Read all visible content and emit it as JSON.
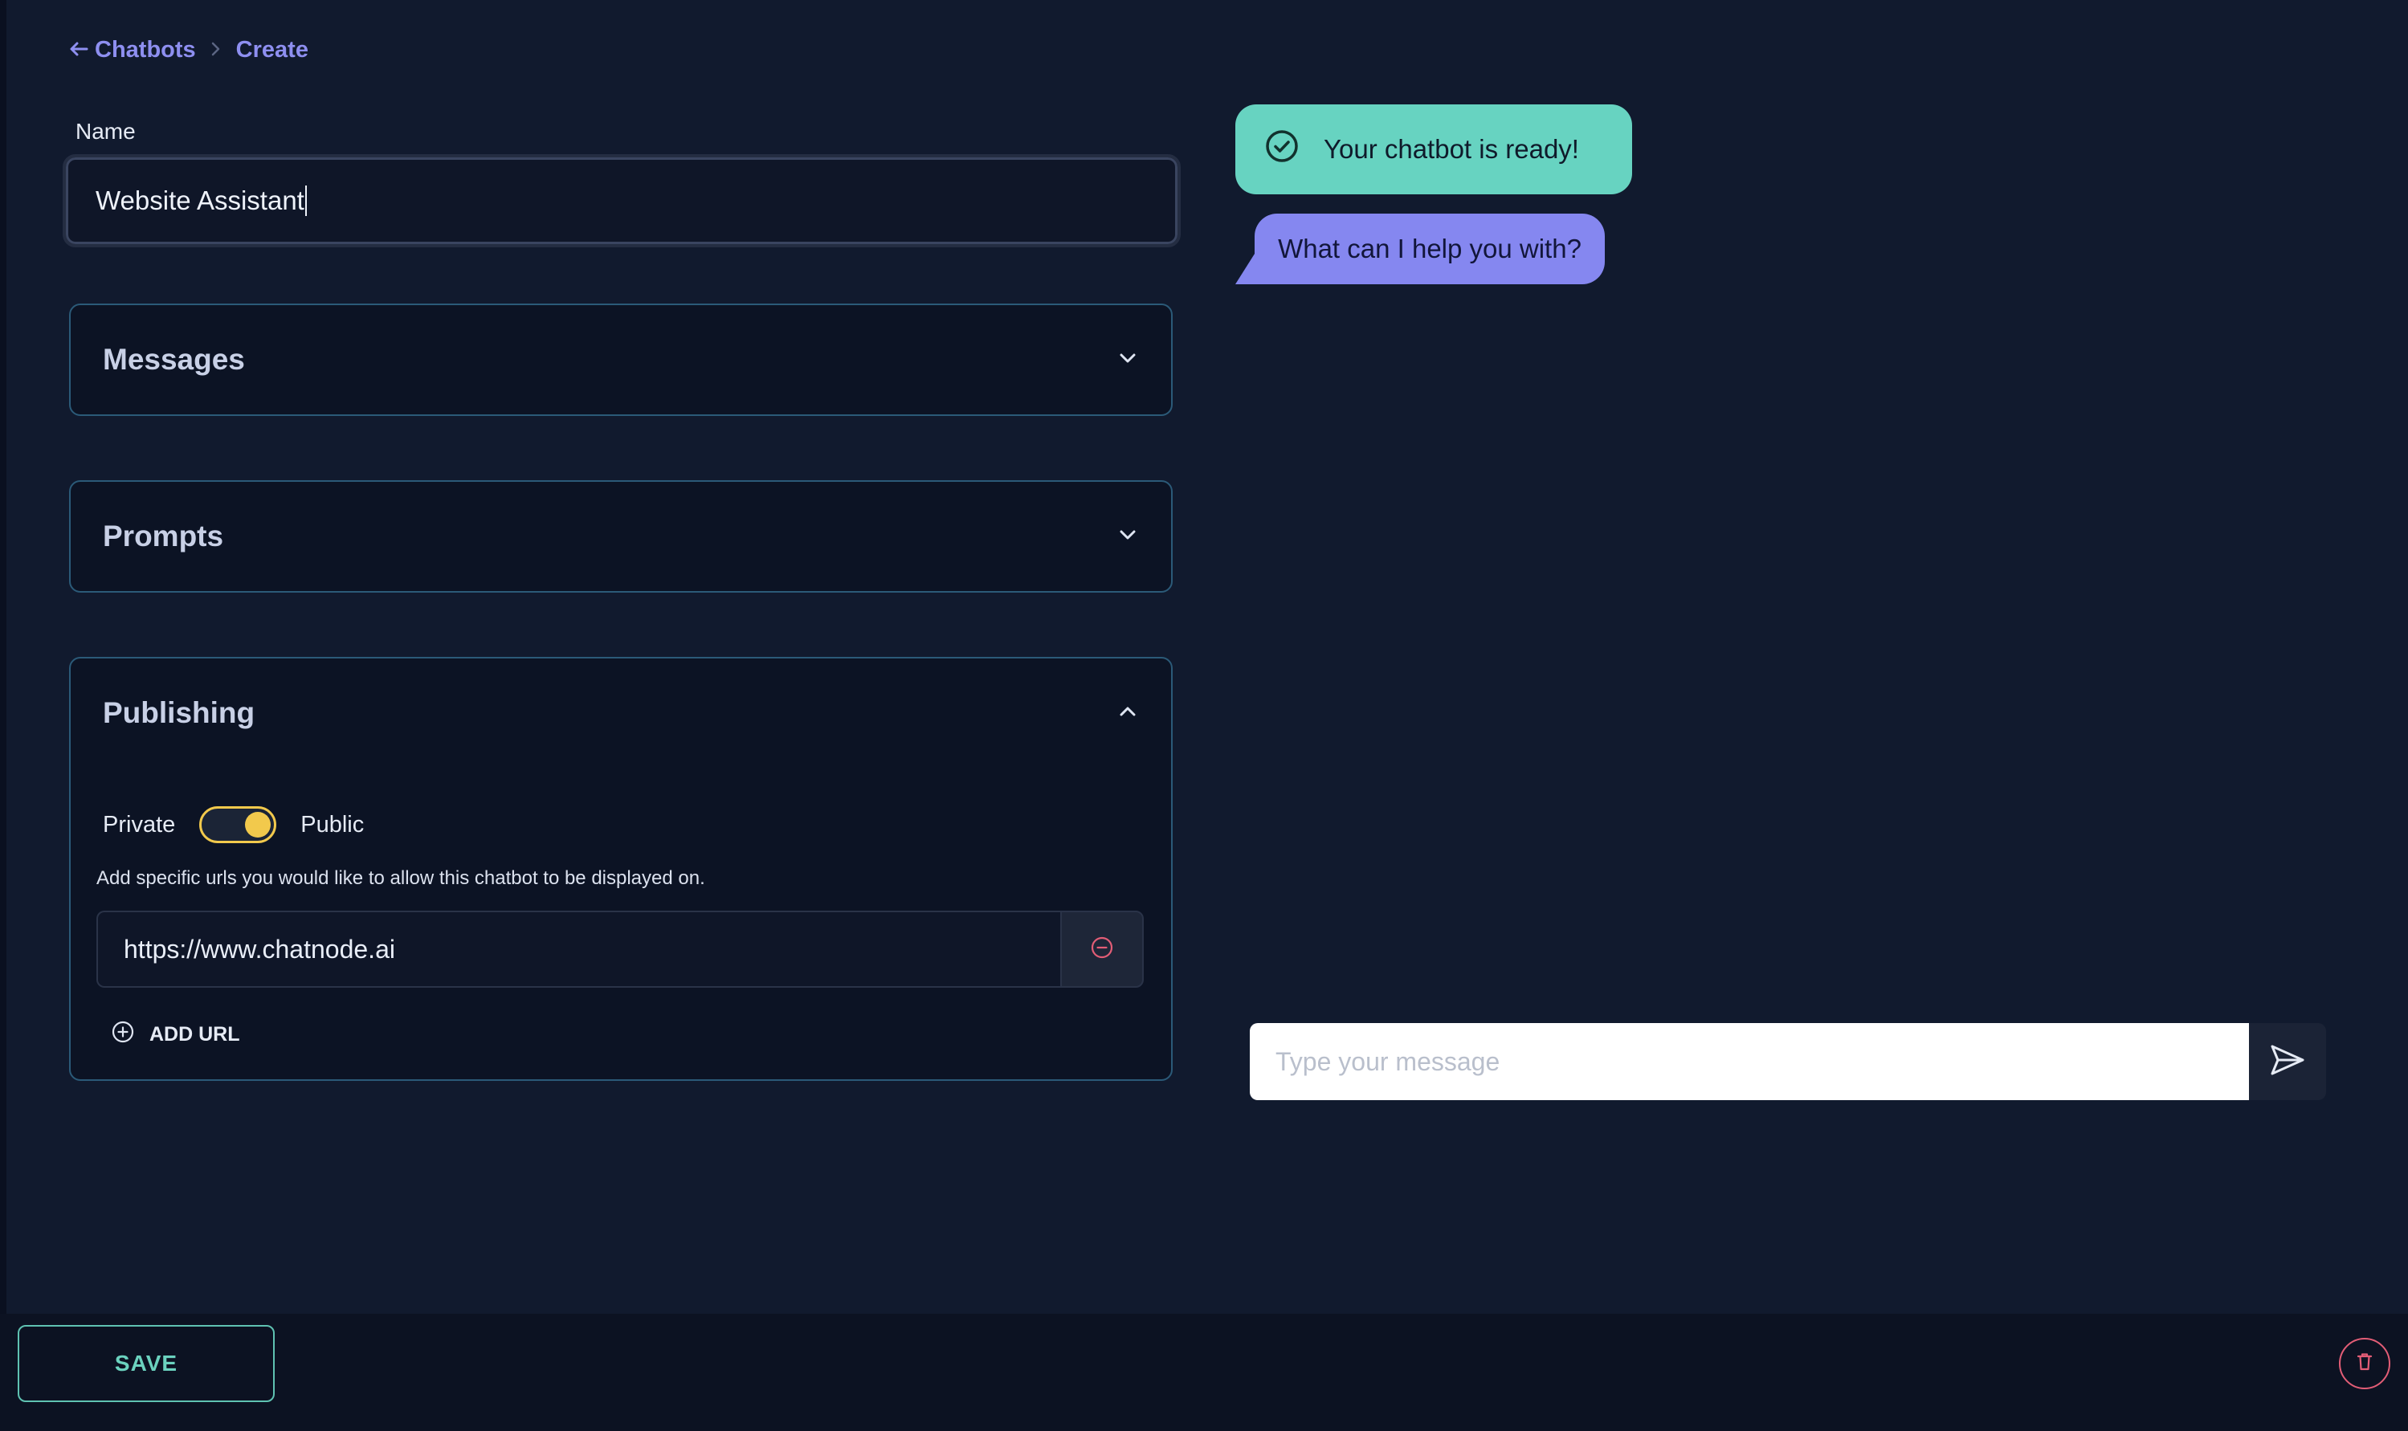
{
  "breadcrumb": {
    "back_label": "Chatbots",
    "current": "Create"
  },
  "form": {
    "name_label": "Name",
    "name_value": "Website Assistant"
  },
  "sections": {
    "messages": {
      "title": "Messages",
      "expanded": false
    },
    "prompts": {
      "title": "Prompts",
      "expanded": false
    },
    "publishing": {
      "title": "Publishing",
      "expanded": true,
      "private_label": "Private",
      "public_label": "Public",
      "is_public": true,
      "hint": "Add specific urls you would like to allow this chatbot to be displayed on.",
      "urls": [
        "https://www.chatnode.ai"
      ],
      "add_url_label": "ADD URL"
    }
  },
  "chat": {
    "status_message": "Your chatbot is ready!",
    "bot_message": "What can I help you with?",
    "input_placeholder": "Type your message"
  },
  "footer": {
    "save_label": "SAVE"
  },
  "colors": {
    "accent": "#8e8ff0",
    "teal": "#67d3c1",
    "toggle": "#f2c94c",
    "danger": "#e25d76"
  },
  "icons": [
    "back-arrow-icon",
    "breadcrumb-separator-icon",
    "chevron-down-icon",
    "chevron-up-icon",
    "minus-circle-icon",
    "plus-circle-icon",
    "check-circle-icon",
    "send-icon",
    "trash-icon"
  ]
}
